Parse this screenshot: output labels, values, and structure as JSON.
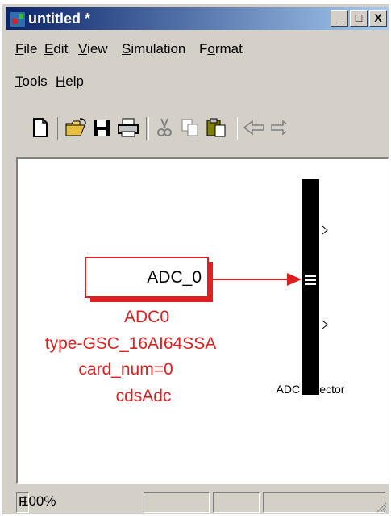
{
  "window": {
    "title": "untitled *",
    "controls": {
      "minimize": "_",
      "maximize": "□",
      "close": "X"
    }
  },
  "menu": {
    "items": [
      "File",
      "Edit",
      "View",
      "Simulation",
      "Format",
      "Tools",
      "Help"
    ],
    "mnemonics": [
      "F",
      "E",
      "V",
      "S",
      "o",
      "T",
      "H"
    ]
  },
  "toolbar": {
    "icons": [
      "new-document-icon",
      "open-folder-icon",
      "save-icon",
      "print-icon",
      "cut-icon",
      "copy-icon",
      "paste-icon",
      "back-arrow-icon",
      "forward-arrow-icon"
    ]
  },
  "diagram": {
    "source_block": {
      "text": "ADC_0",
      "annotation": [
        "ADC0",
        "type-GSC_16AI64SSA",
        "card_num=0",
        "cdsAdc"
      ]
    },
    "selector_block": {
      "label": "ADC Selector"
    },
    "colors": {
      "block": "#e02020",
      "selector": "#000000"
    }
  },
  "status": {
    "prefix": "F",
    "zoom": "100%"
  }
}
